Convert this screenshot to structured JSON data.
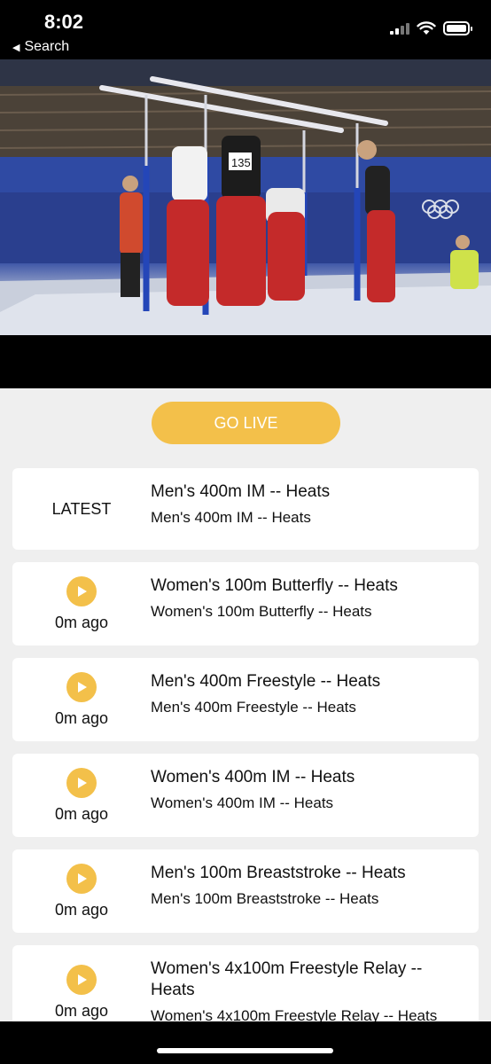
{
  "status_bar": {
    "time": "8:02",
    "back_label": "Search"
  },
  "video": {
    "description_icon": "gymnastics-video-frame"
  },
  "go_live_label": "GO LIVE",
  "items": [
    {
      "badge": "LATEST",
      "title": "Men's 400m IM -- Heats",
      "subtitle": "Men's 400m IM -- Heats"
    },
    {
      "ago": "0m ago",
      "title": "Women's 100m Butterfly -- Heats",
      "subtitle": "Women's 100m Butterfly -- Heats"
    },
    {
      "ago": "0m ago",
      "title": "Men's 400m Freestyle -- Heats",
      "subtitle": "Men's 400m Freestyle -- Heats"
    },
    {
      "ago": "0m ago",
      "title": "Women's 400m IM -- Heats",
      "subtitle": "Women's 400m IM -- Heats"
    },
    {
      "ago": "0m ago",
      "title": "Men's 100m Breaststroke -- Heats",
      "subtitle": "Men's 100m Breaststroke -- Heats"
    },
    {
      "ago": "0m ago",
      "title": "Women's 4x100m Freestyle Relay -- Heats",
      "subtitle": "Women's 4x100m Freestyle Relay -- Heats"
    }
  ],
  "colors": {
    "accent": "#f3c04a",
    "background": "#efefef",
    "card": "#ffffff"
  }
}
